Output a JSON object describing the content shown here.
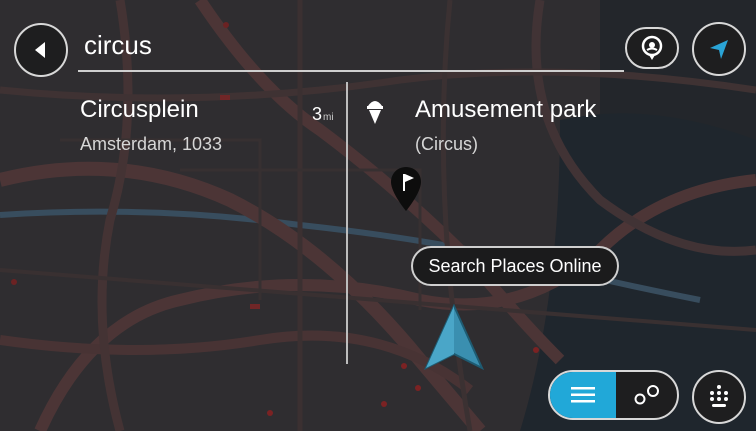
{
  "search": {
    "query": "circus"
  },
  "results": [
    {
      "title": "Circusplein",
      "subtitle": "Amsterdam, 1033",
      "distance_value": "3",
      "distance_unit": "mi"
    },
    {
      "title": "Amusement park",
      "subtitle": "(Circus)"
    }
  ],
  "actions": {
    "search_online_label": "Search Places Online"
  },
  "icons": {
    "back": "back-arrow-icon",
    "pin": "location-pin-icon",
    "navigate": "navigation-arrow-icon",
    "amusement": "ice-cream-icon",
    "flag_marker": "flag-marker-icon",
    "current_position": "current-position-arrow-icon",
    "list": "list-view-icon",
    "map_view": "map-pins-icon",
    "keyboard": "keyboard-icon"
  },
  "colors": {
    "accent": "#21a8d8",
    "position_arrow": "#3a8fb0"
  }
}
